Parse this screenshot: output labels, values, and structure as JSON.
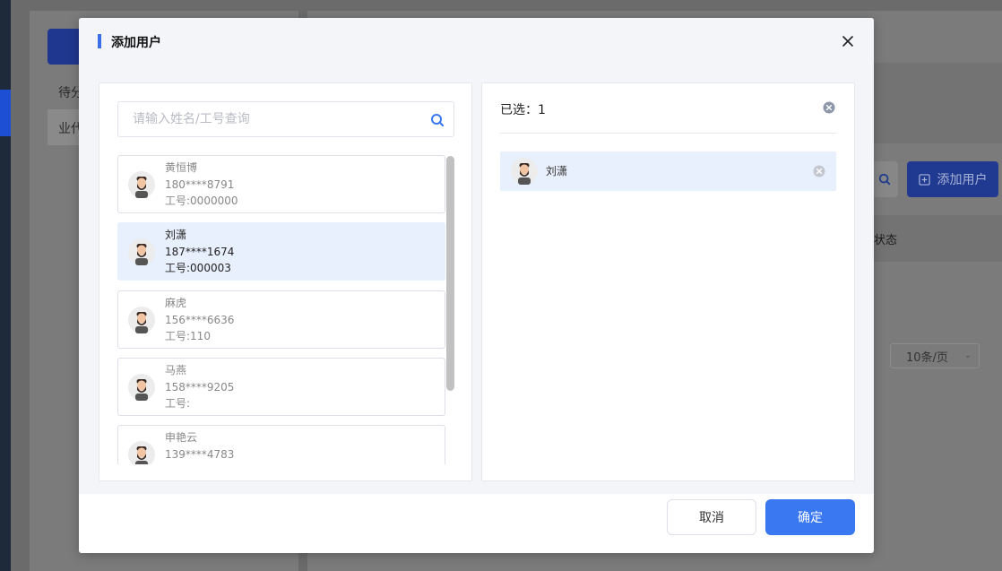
{
  "background": {
    "sidebar_items": [
      "待分",
      "业代"
    ],
    "add_user_label": "添加用户",
    "table_col_status": "状态",
    "page_size": "10条/页"
  },
  "modal": {
    "title": "添加用户",
    "search": {
      "placeholder": "请输入姓名/工号查询",
      "value": ""
    },
    "users": [
      {
        "name": "黄恒博",
        "phone": "180****8791",
        "job_id": "工号:0000000",
        "selected": false
      },
      {
        "name": "刘潇",
        "phone": "187****1674",
        "job_id": "工号:000003",
        "selected": true
      },
      {
        "name": "麻虎",
        "phone": "156****6636",
        "job_id": "工号:110",
        "selected": false
      },
      {
        "name": "马燕",
        "phone": "158****9205",
        "job_id": "工号:",
        "selected": false
      },
      {
        "name": "申艳云",
        "phone": "139****4783",
        "job_id": "",
        "selected": false
      }
    ],
    "selected_panel": {
      "label": "已选：1",
      "items": [
        {
          "name": "刘潇"
        }
      ]
    },
    "cancel_label": "取消",
    "confirm_label": "确定"
  },
  "colors": {
    "accent": "#3a78f2",
    "selected_bg": "#e8f0fd",
    "title_bar": "#3b6fe8"
  },
  "icons": {
    "close": "close-icon",
    "search": "search-icon",
    "avatar": "avatar-icon",
    "clear": "clear-circle-icon",
    "plus_square": "plus-square-icon",
    "chevron": "chevron-down-icon"
  }
}
